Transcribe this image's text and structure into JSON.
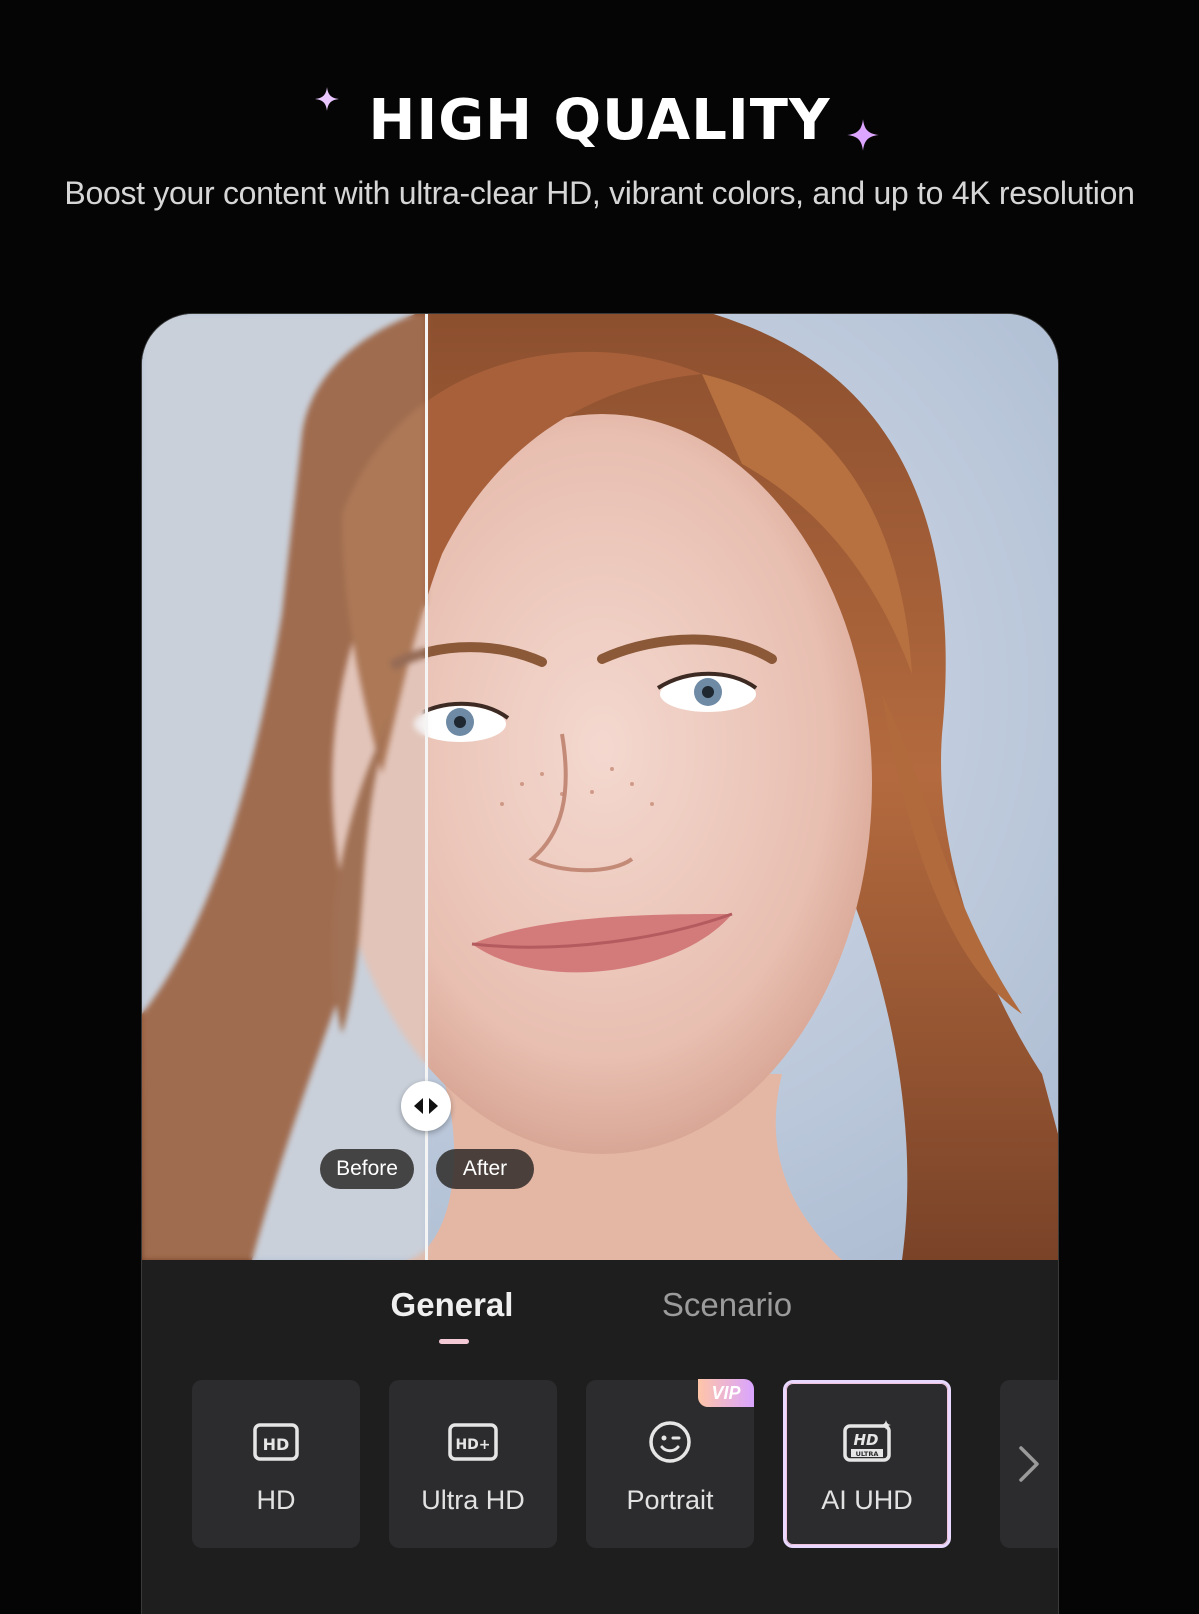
{
  "header": {
    "title": "HIGH QUALITY",
    "subtitle": "Boost your content with ultra-clear HD, vibrant colors, and up to 4K resolution"
  },
  "compare": {
    "before_label": "Before",
    "after_label": "After"
  },
  "tabs": [
    {
      "label": "General",
      "active": true
    },
    {
      "label": "Scenario",
      "active": false
    }
  ],
  "tools": [
    {
      "label": "HD",
      "icon": "hd-icon",
      "badge": "",
      "selected": false
    },
    {
      "label": "Ultra HD",
      "icon": "hd-plus-icon",
      "badge": "",
      "selected": false
    },
    {
      "label": "Portrait",
      "icon": "face-icon",
      "badge": "VIP",
      "selected": false
    },
    {
      "label": "AI UHD",
      "icon": "hd-ultra-icon",
      "badge": "",
      "selected": true
    }
  ],
  "colors": {
    "background": "#050505",
    "accent": "#d7a6ff",
    "panel": "#1e1e1e",
    "tile": "#2c2c2e"
  }
}
